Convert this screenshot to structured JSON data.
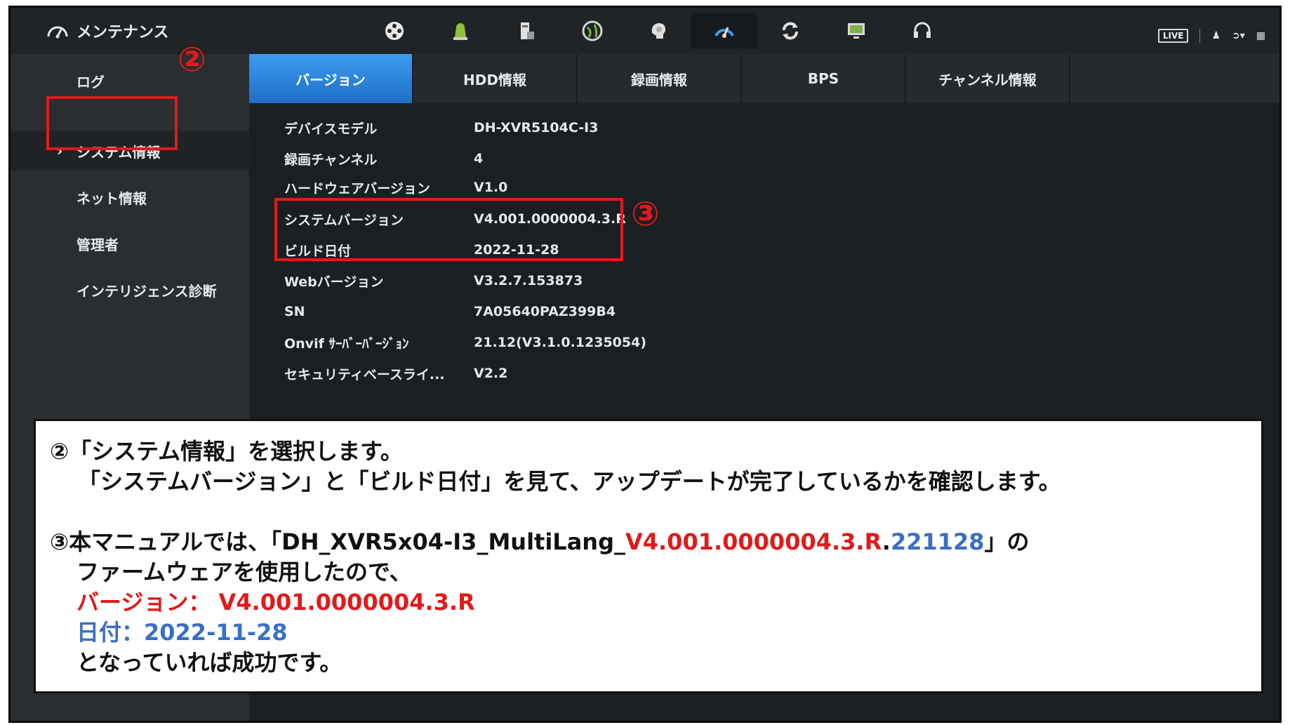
{
  "header": {
    "title": "メンテナンス",
    "live_label": "LIVE",
    "toolbar_icons": [
      "film-reel-icon",
      "alarm-bell-icon",
      "storage-icon",
      "network-globe-icon",
      "ai-brain-icon",
      "maintenance-gauge-icon",
      "refresh-icon",
      "monitor-icon",
      "headset-icon"
    ]
  },
  "sidebar": {
    "items": [
      {
        "label": "ログ"
      },
      {
        "label": "システム情報",
        "arrow": "›"
      },
      {
        "label": "ネット情報"
      },
      {
        "label": "管理者"
      },
      {
        "label": "インテリジェンス診断"
      }
    ]
  },
  "tabs": [
    {
      "label": "バージョン"
    },
    {
      "label": "HDD情報"
    },
    {
      "label": "録画情報"
    },
    {
      "label": "BPS"
    },
    {
      "label": "チャンネル情報"
    }
  ],
  "info": [
    {
      "label": "デバイスモデル",
      "value": "DH-XVR5104C-I3"
    },
    {
      "label": "録画チャンネル",
      "value": "4"
    },
    {
      "label": "ハードウェアバージョン",
      "value": "V1.0"
    },
    {
      "label": "システムバージョン",
      "value": "V4.001.0000004.3.R"
    },
    {
      "label": "ビルド日付",
      "value": "2022-11-28"
    },
    {
      "label": "Webバージョン",
      "value": "V3.2.7.153873"
    },
    {
      "label": "SN",
      "value": "7A05640PAZ399B4"
    },
    {
      "label": "Onvif ｻｰﾊﾞｰﾊﾞｰｼﾞｮﾝ",
      "value": "21.12(V3.1.0.1235054)"
    },
    {
      "label": "セキュリティベースライ...",
      "value": "V2.2"
    }
  ],
  "callouts": {
    "num2": "②",
    "num3": "③"
  },
  "note": {
    "line1": "②「システム情報」を選択します。",
    "line2": "「システムバージョン」と「ビルド日付」を見て、アップデートが完了しているかを確認します。",
    "line3_a": "③本マニュアルでは、「DH_XVR5x04-I3_MultiLang_",
    "line3_red": "V4.001.0000004.3.R",
    "line3_dot": ".",
    "line3_blue": "221128",
    "line3_end": "」の",
    "line4": "ファームウェアを使用したので、",
    "line5": "バージョン： V4.001.0000004.3.R",
    "line6": "日付：2022-11-28",
    "line7": "となっていれば成功です。"
  },
  "colors": {
    "accent_red": "#e11a1a",
    "accent_blue": "#3a6fc4",
    "tab_active": "#2a86de"
  }
}
